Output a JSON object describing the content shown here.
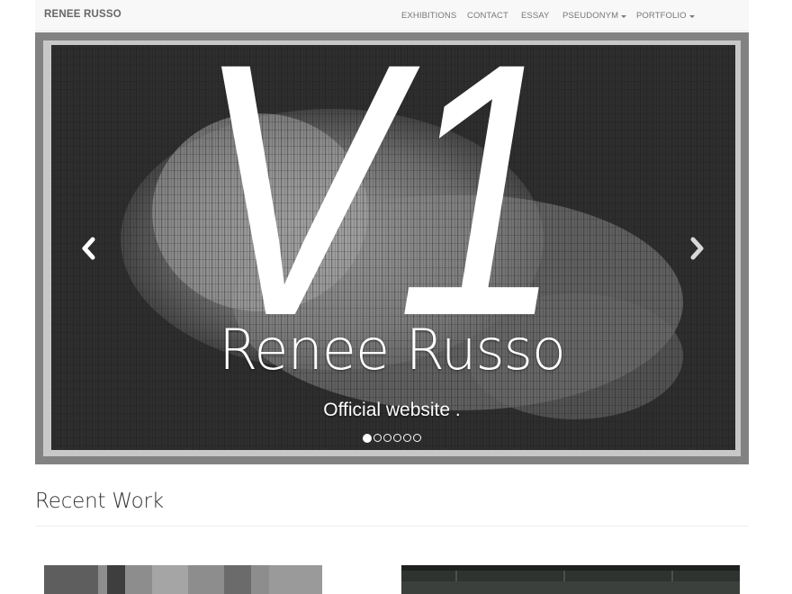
{
  "navbar": {
    "brand": "RENEE RUSSO",
    "items": [
      {
        "label": "EXHIBITIONS",
        "dropdown": false
      },
      {
        "label": "CONTACT",
        "dropdown": false
      },
      {
        "label": "ESSAY",
        "dropdown": false
      },
      {
        "label": "PSEUDONYM",
        "dropdown": true
      },
      {
        "label": "PORTFOLIO",
        "dropdown": true
      }
    ]
  },
  "carousel": {
    "logo_text": "V1",
    "title": "Renee Russo",
    "subtitle": "Official website .",
    "slide_count": 6,
    "active_slide": 1,
    "prev_icon": "chevron-left-icon",
    "next_icon": "chevron-right-icon"
  },
  "recent": {
    "heading": "Recent Work"
  },
  "colors": {
    "navbar_bg": "#f8f8f8",
    "nav_text": "#777777",
    "brand_text": "#666666",
    "overlay_text": "#ffffff"
  }
}
